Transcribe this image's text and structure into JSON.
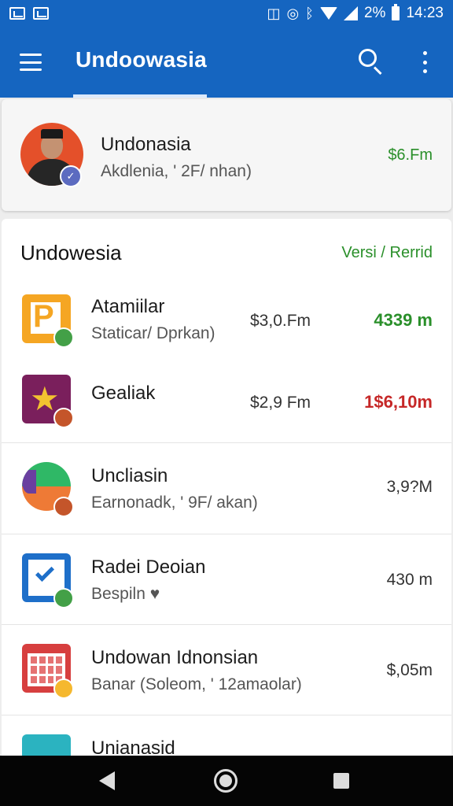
{
  "status_bar": {
    "battery_text": "2%",
    "time": "14:23",
    "icons": [
      "image-notification-icon",
      "cast-notification-icon",
      "vibrate-icon",
      "alarm-icon",
      "bluetooth-icon",
      "wifi-icon",
      "signal-icon",
      "battery-icon"
    ]
  },
  "app_bar": {
    "title": "Undoowasia",
    "icons": [
      "menu-icon",
      "search-icon",
      "more-vert-icon"
    ]
  },
  "profile": {
    "name": "Undonasia",
    "subtitle": "Akdlenia, ' 2F/ nhan)",
    "value": "$6.Fm"
  },
  "section": {
    "title": "Undowesia",
    "link": "Versi / Rerrid"
  },
  "apps": [
    {
      "title": "Atamiilar",
      "subtitle": "Staticar/ Dprkan)",
      "price": "$3,0.Fm",
      "change": "4339 m",
      "change_color": "#2a8f2a",
      "icon": "parking-app-icon"
    },
    {
      "title": "Gealiak",
      "subtitle": "",
      "price": "$2,9 Fm",
      "change": "1$6,10m",
      "change_color": "#c62828",
      "icon": "star-app-icon"
    },
    {
      "title": "Uncliasin",
      "subtitle": "Earnonadk, ' 9F/ akan)",
      "value": "3,9?M",
      "icon": "pie-app-icon"
    },
    {
      "title": "Radei Deoian",
      "subtitle": "Bespiln ♥",
      "value": "430 m",
      "icon": "checkbox-app-icon"
    },
    {
      "title": "Undowan Idnonsian",
      "subtitle": "Banar (Soleom, ' 12amaolar)",
      "value": "$,05m",
      "icon": "calendar-app-icon"
    },
    {
      "title": "Unianasid",
      "icon": "house-app-icon"
    }
  ],
  "nav_bar": {
    "icons": [
      "back-icon",
      "home-icon",
      "recents-icon"
    ]
  }
}
